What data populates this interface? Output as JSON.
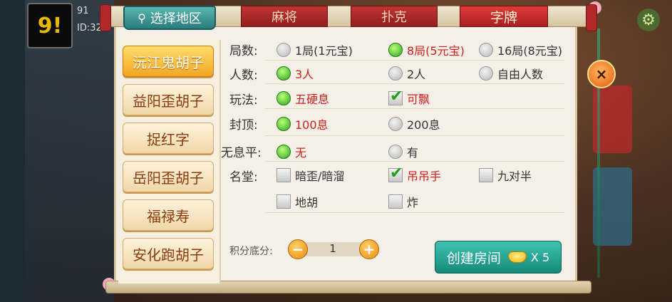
{
  "background": {
    "user_id_partial": "91",
    "id_label": "ID:32"
  },
  "tabs": {
    "region": "选择地区",
    "mahjong": "麻将",
    "poker": "扑克",
    "zipai": "字牌"
  },
  "variants": [
    "沅江鬼胡子",
    "益阳歪胡子",
    "捉红字",
    "岳阳歪胡子",
    "福禄寿",
    "安化跑胡子"
  ],
  "active_variant": "沅江鬼胡子",
  "options": {
    "rounds": {
      "label": "局数:",
      "items": [
        "1局(1元宝)",
        "8局(5元宝)",
        "16局(8元宝)"
      ],
      "selected": "8局(5元宝)"
    },
    "players": {
      "label": "人数:",
      "items": [
        "3人",
        "2人",
        "自由人数"
      ],
      "selected": "3人"
    },
    "play": {
      "label": "玩法:",
      "items": [
        "五硬息",
        "可飘"
      ],
      "checked": [
        "五硬息",
        "可飘"
      ]
    },
    "cap": {
      "label": "封顶:",
      "items": [
        "100息",
        "200息"
      ],
      "selected": "100息"
    },
    "no_xi": {
      "label": "无息平:",
      "items": [
        "无",
        "有"
      ],
      "selected": "无"
    },
    "mingtang": {
      "label": "名堂:",
      "items": [
        "暗歪/暗溜",
        "吊吊手",
        "九对半",
        "地胡",
        "炸"
      ],
      "checked": [
        "吊吊手"
      ]
    }
  },
  "score": {
    "label": "积分底分:",
    "value": "1",
    "minus": "−",
    "plus": "+"
  },
  "create": {
    "label": "创建房间",
    "multiplier": "X 5"
  },
  "close_label": "×",
  "colors": {
    "accent_teal": "#15897a",
    "selected_red": "#d21e1e",
    "tab_red": "#b02828",
    "variant_gold": "#f2a623"
  }
}
